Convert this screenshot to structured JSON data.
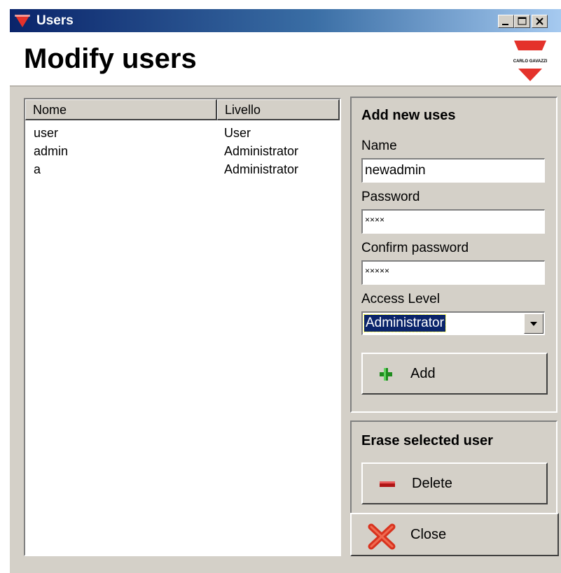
{
  "window": {
    "title": "Users",
    "controls": {
      "minimize": "minimize",
      "maximize": "maximize",
      "close": "close"
    }
  },
  "header": {
    "title": "Modify users",
    "logo_text": "CARLO GAVAZZI"
  },
  "users_list": {
    "columns": [
      "Nome",
      "Livello"
    ],
    "rows": [
      {
        "name": "user",
        "level": "User"
      },
      {
        "name": "admin",
        "level": "Administrator"
      },
      {
        "name": "a",
        "level": "Administrator"
      }
    ]
  },
  "add_panel": {
    "title": "Add new uses",
    "name_label": "Name",
    "name_value": "newadmin",
    "password_label": "Password",
    "password_value": "××××",
    "confirm_label": "Confirm password",
    "confirm_value": "×××××",
    "access_label": "Access Level",
    "access_value": "Administrator",
    "add_button": "Add"
  },
  "erase_panel": {
    "title": "Erase selected user",
    "delete_button": "Delete"
  },
  "close_button": "Close",
  "colors": {
    "face": "#d4d0c8",
    "title_gradient_start": "#0a246a",
    "title_gradient_end": "#a6caf0",
    "brand_red": "#e4322b",
    "selection": "#0a246a"
  },
  "icons": {
    "app": "carlo-gavazzi-triangle-icon",
    "add": "green-plus-icon",
    "delete": "red-minus-icon",
    "close": "red-x-icon"
  }
}
